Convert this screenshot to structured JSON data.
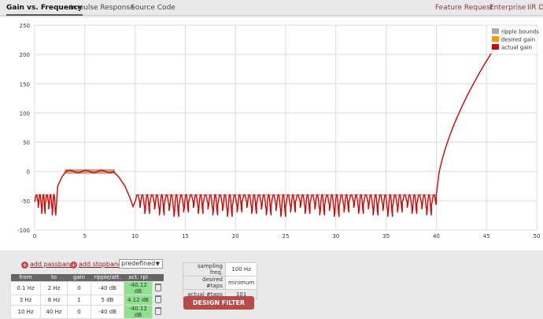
{
  "nav": {
    "tabs": [
      {
        "label": "Gain vs. Frequency",
        "active": true
      },
      {
        "label": "Impulse Response",
        "active": false
      },
      {
        "label": "Source Code",
        "active": false
      }
    ],
    "links": [
      "Feature Request",
      "Enterprise",
      "IIR De"
    ]
  },
  "chart_data": {
    "type": "line",
    "title": "",
    "xlabel": "",
    "ylabel": "",
    "xlim": [
      0,
      50
    ],
    "ylim": [
      -100,
      250
    ],
    "x_ticks": [
      0,
      5,
      10,
      15,
      20,
      25,
      30,
      35,
      40,
      45,
      50
    ],
    "y_ticks": [
      -100,
      -50,
      0,
      50,
      100,
      150,
      200,
      250
    ],
    "grid": true,
    "legend_position": "top-right",
    "series": [
      {
        "name": "ripple bounds",
        "color": "#aaaaaa"
      },
      {
        "name": "desired gain",
        "color": "#ff9900"
      },
      {
        "name": "actual gain",
        "color": "#dd0000"
      }
    ],
    "ripple_bounds": [
      {
        "x": [
          3,
          8
        ],
        "y": [
          -4,
          4
        ]
      }
    ],
    "desired_gain_segments": [
      {
        "x": [
          3,
          8
        ],
        "y": 0
      }
    ],
    "stopband_bounds": [
      {
        "x": [
          0.1,
          2
        ],
        "y": -40
      },
      {
        "x": [
          10,
          40
        ],
        "y": -40
      }
    ],
    "actual_gain_summary": {
      "stopband_level_db": -40,
      "passband_level_db": 0,
      "rise_start_hz": 40,
      "end_point": {
        "x": 47,
        "y": 242
      }
    }
  },
  "controls": {
    "add_passband": "add passband",
    "add_stopband": "add stopband",
    "predefined": "predefined"
  },
  "bands": {
    "headers": [
      "from",
      "to",
      "gain",
      "ripple/att.",
      "act. rpl"
    ],
    "rows": [
      [
        "0.1 Hz",
        "2 Hz",
        "0",
        "-40 dB",
        "-40.12 dB"
      ],
      [
        "3 Hz",
        "8 Hz",
        "1",
        "5 dB",
        "4.12 dB"
      ],
      [
        "10 Hz",
        "40 Hz",
        "0",
        "-40 dB",
        "-40.12 dB"
      ]
    ]
  },
  "params": {
    "rows": [
      {
        "label": "sampling freq.",
        "value": "100 Hz",
        "editable": true
      },
      {
        "label": "desired #taps",
        "value": "minimum",
        "editable": true
      },
      {
        "label": "actual #taps",
        "value": "101",
        "editable": false
      }
    ]
  },
  "design_button": "DESIGN FILTER"
}
